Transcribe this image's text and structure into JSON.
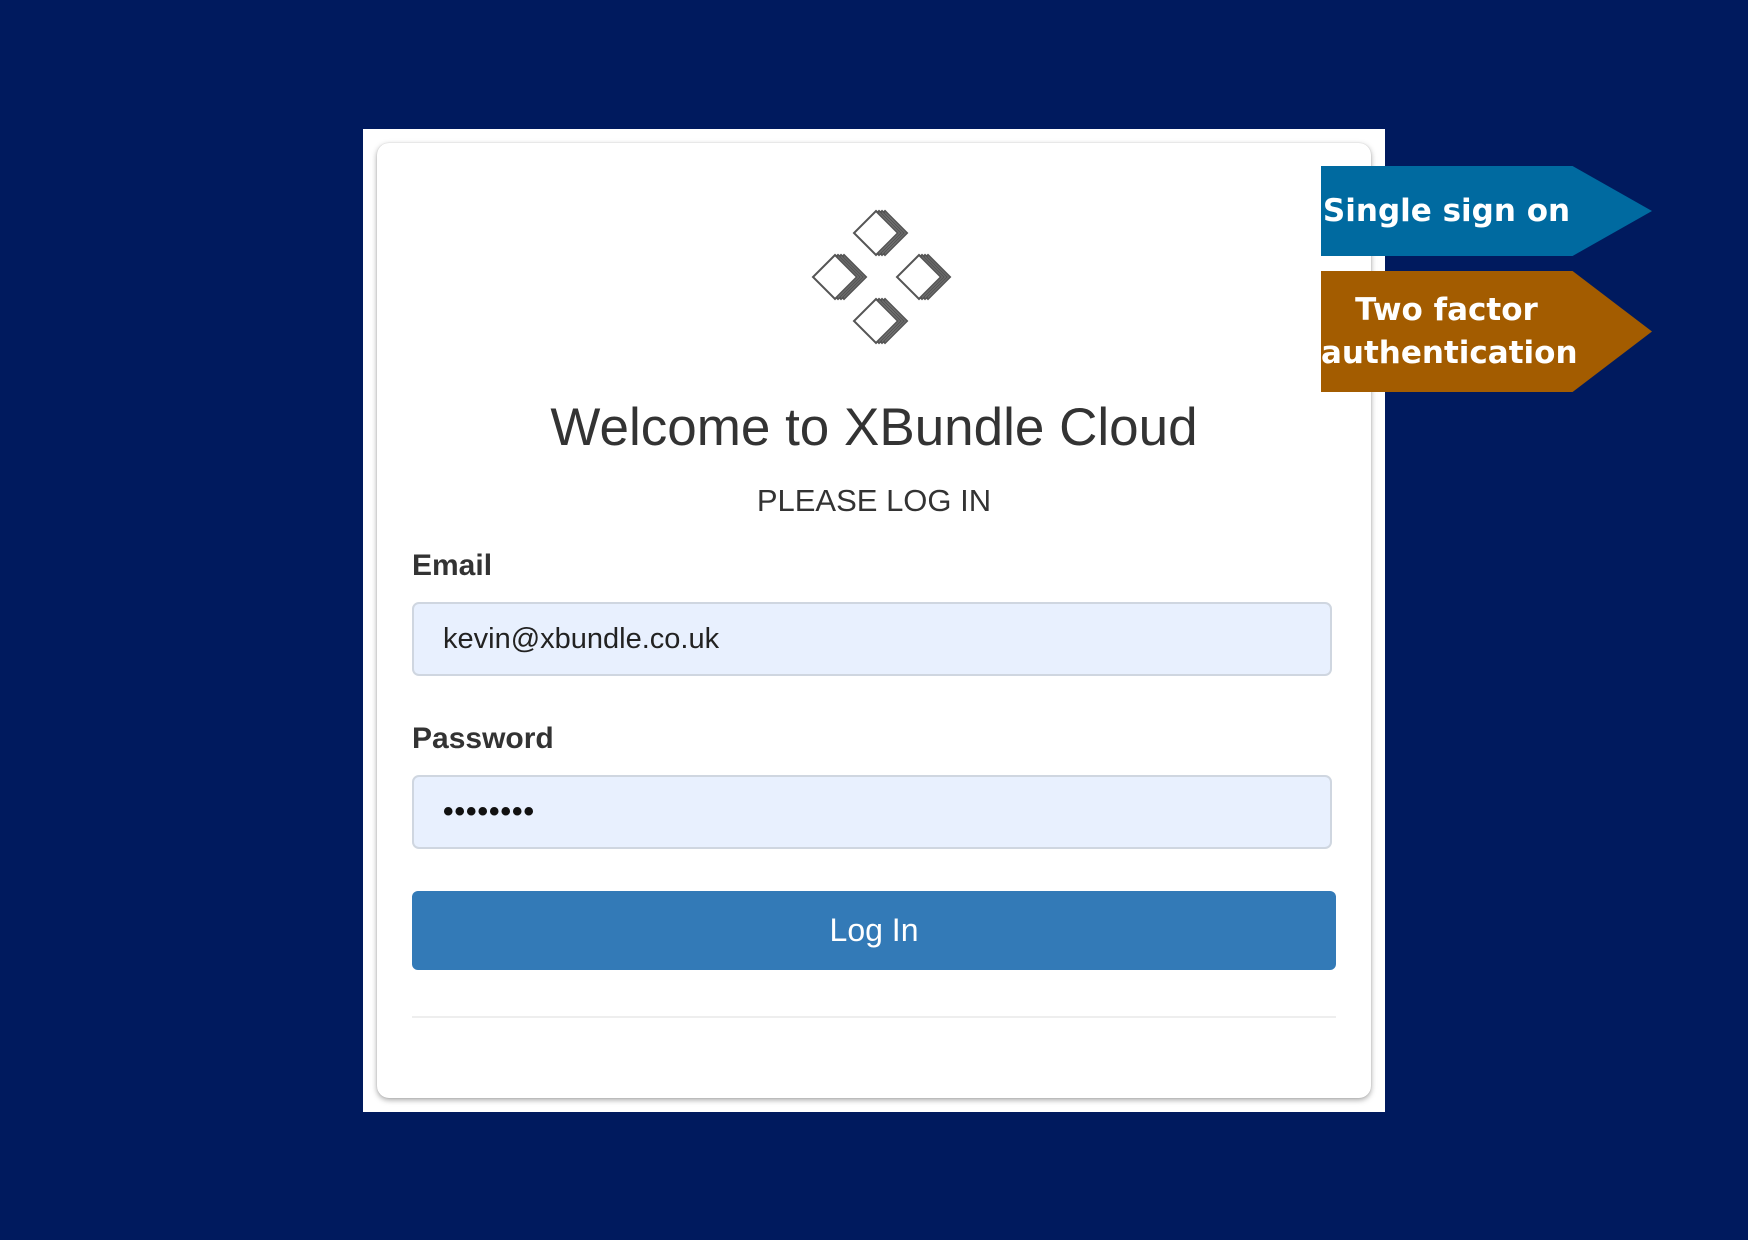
{
  "login": {
    "title": "Welcome to XBundle Cloud",
    "subtitle": "PLEASE LOG IN",
    "email_label": "Email",
    "email_value": "kevin@xbundle.co.uk",
    "password_label": "Password",
    "password_value": "••••••••",
    "submit_label": "Log In"
  },
  "callouts": {
    "sso": "Single sign on",
    "two_factor_line1": "Two factor",
    "two_factor_line2": "authentication"
  },
  "icons": {
    "logo": "stacked-diamonds-logo-icon"
  },
  "colors": {
    "page_background": "#001a5e",
    "button": "#337ab7",
    "input_background": "#e8f0fe",
    "sso_callout": "#006aa0",
    "two_factor_callout": "#a35c00"
  }
}
